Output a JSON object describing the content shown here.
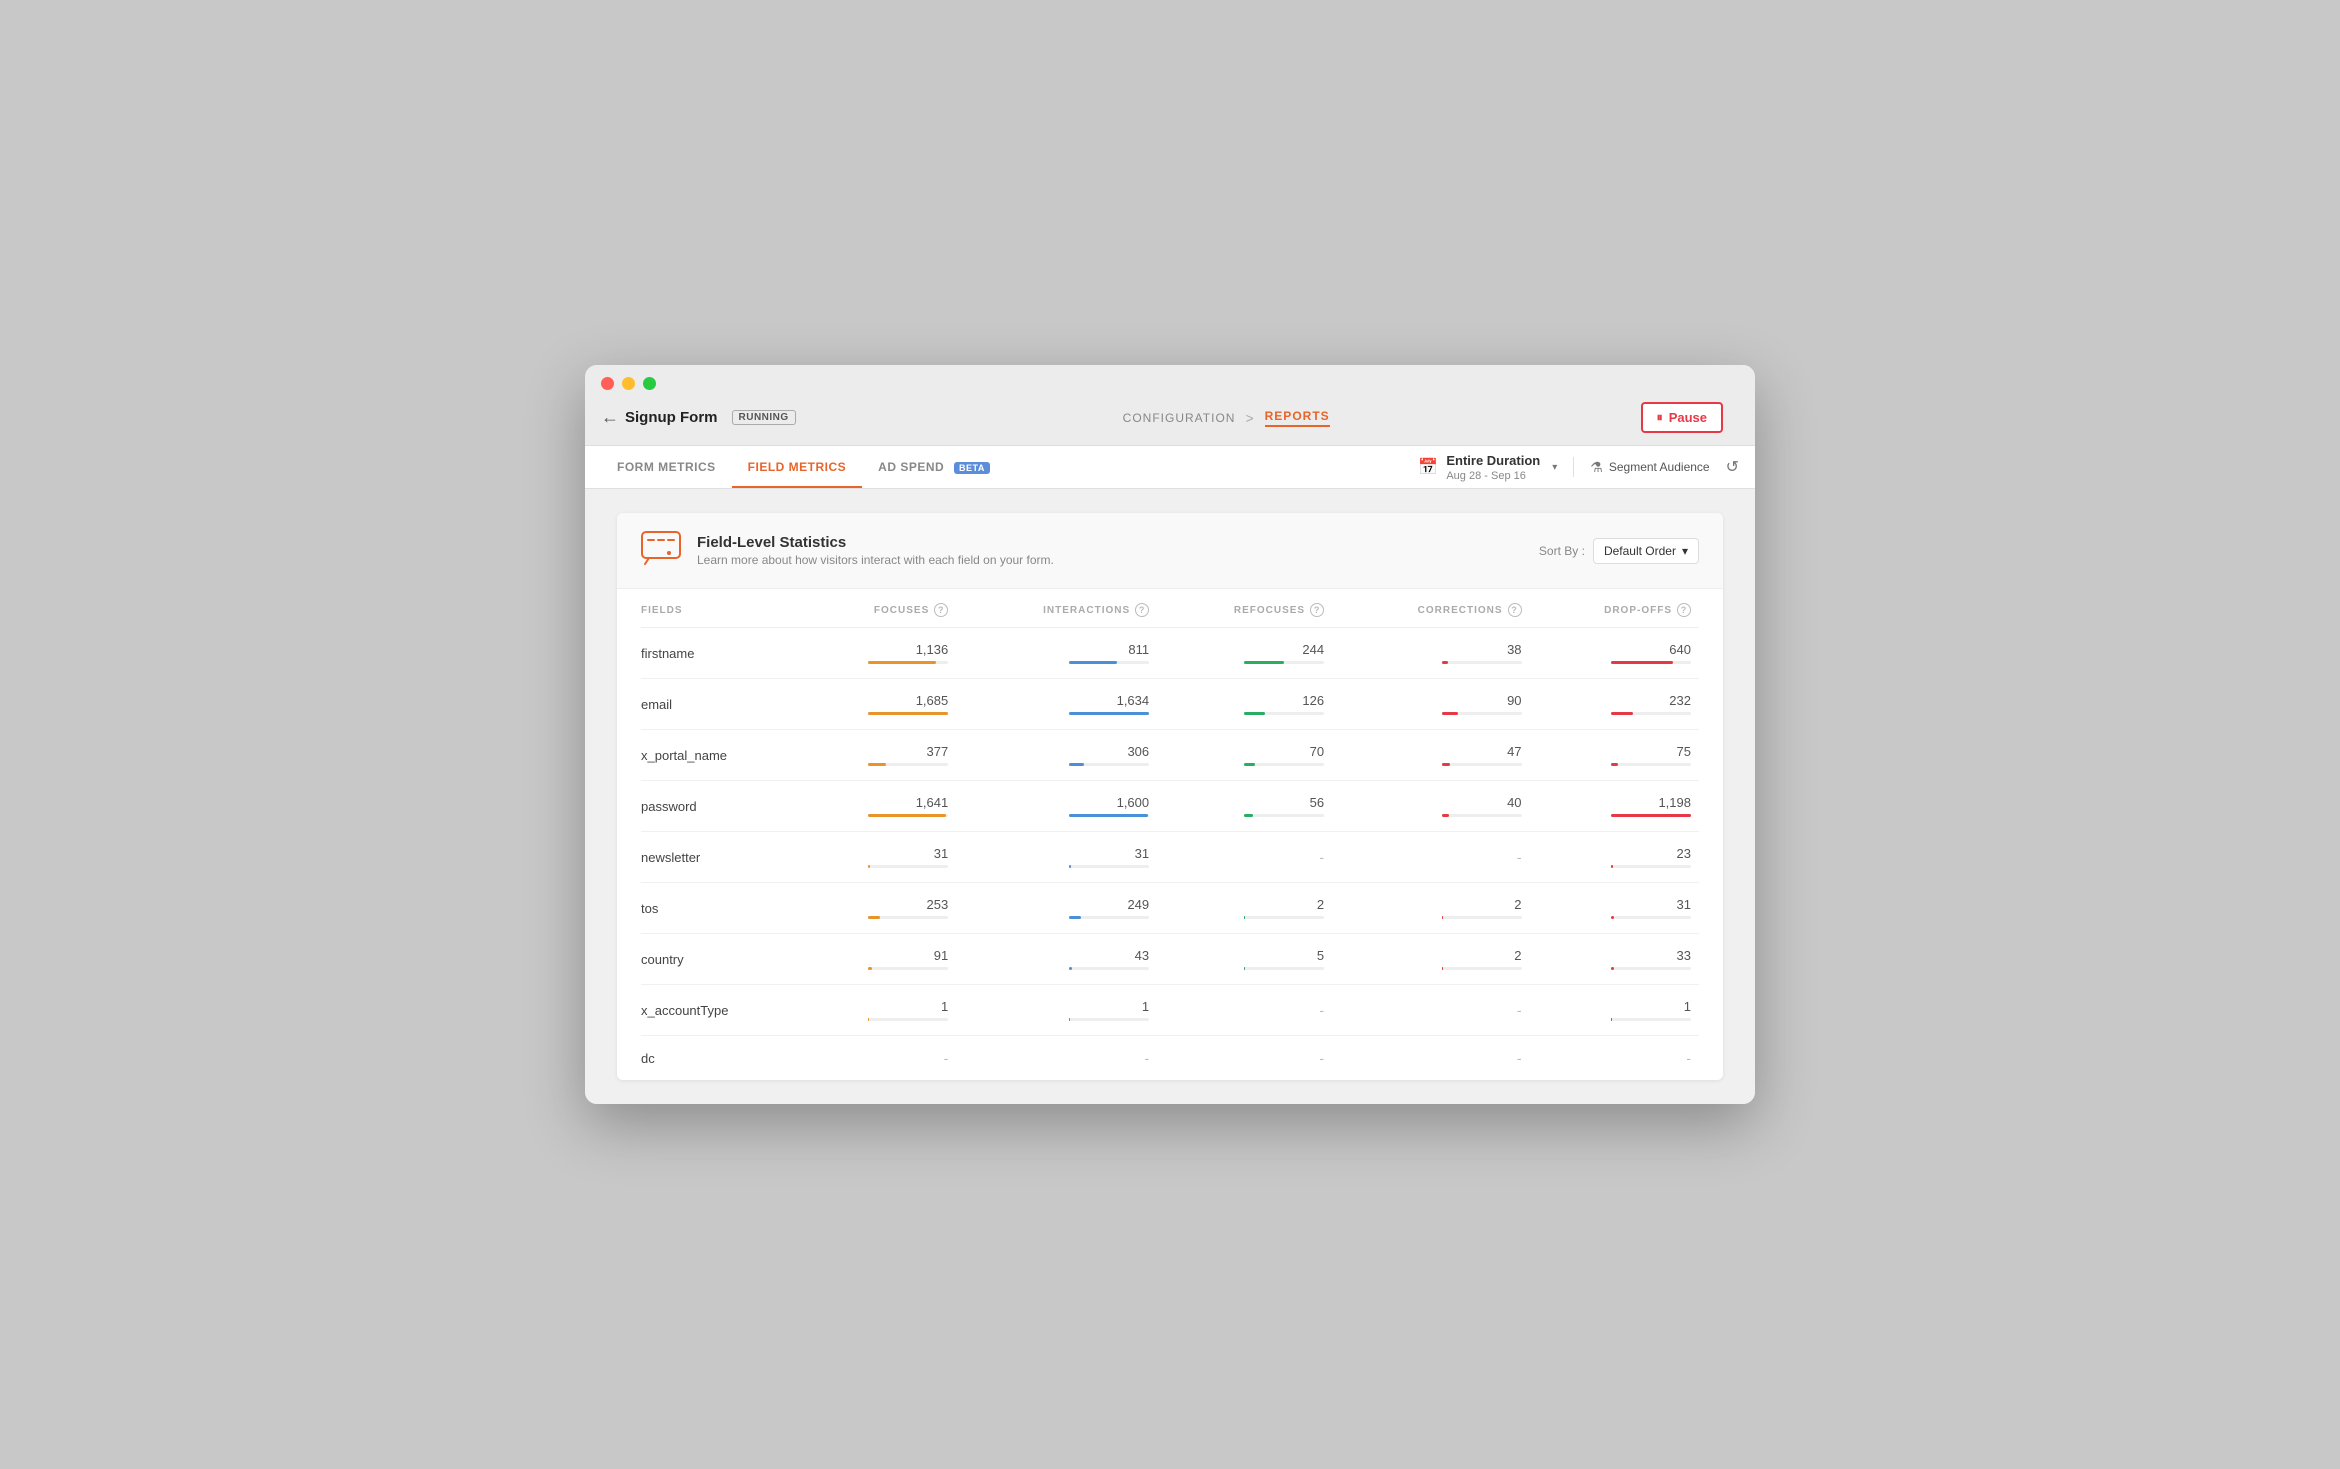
{
  "window": {
    "title": "Signup Form"
  },
  "header": {
    "back_label": "Signup Form",
    "running_badge": "RUNNING",
    "breadcrumb_config": "CONFIGURATION",
    "breadcrumb_sep": ">",
    "breadcrumb_reports": "REPORTS",
    "pause_label": "Pause"
  },
  "nav": {
    "tabs": [
      {
        "id": "form-metrics",
        "label": "FORM METRICS",
        "active": false
      },
      {
        "id": "field-metrics",
        "label": "FIELD METRICS",
        "active": true
      },
      {
        "id": "ad-spend",
        "label": "AD SPEND",
        "active": false,
        "beta": true
      }
    ],
    "date_label": "Entire Duration",
    "date_sub": "Aug 28 - Sep 16",
    "segment_label": "Segment Audience",
    "sort_label": "Sort By :",
    "sort_value": "Default Order"
  },
  "stats": {
    "title": "Field-Level Statistics",
    "subtitle": "Learn more about how visitors interact with each field on your form.",
    "columns": [
      "FIELDS",
      "FOCUSES",
      "INTERACTIONS",
      "REFOCUSES",
      "CORRECTIONS",
      "DROP-OFFS"
    ],
    "rows": [
      {
        "field": "firstname",
        "focuses": "1,136",
        "focuses_pct": 85,
        "interactions": "811",
        "interactions_pct": 60,
        "refocuses": "244",
        "refocuses_pct": 50,
        "corrections": "38",
        "corrections_pct": 8,
        "dropoffs": "640",
        "dropoffs_pct": 78
      },
      {
        "field": "email",
        "focuses": "1,685",
        "focuses_pct": 100,
        "interactions": "1,634",
        "interactions_pct": 100,
        "refocuses": "126",
        "refocuses_pct": 26,
        "corrections": "90",
        "corrections_pct": 20,
        "dropoffs": "232",
        "dropoffs_pct": 28
      },
      {
        "field": "x_portal_name",
        "focuses": "377",
        "focuses_pct": 22,
        "interactions": "306",
        "interactions_pct": 19,
        "refocuses": "70",
        "refocuses_pct": 14,
        "corrections": "47",
        "corrections_pct": 10,
        "dropoffs": "75",
        "dropoffs_pct": 9
      },
      {
        "field": "password",
        "focuses": "1,641",
        "focuses_pct": 97,
        "interactions": "1,600",
        "interactions_pct": 98,
        "refocuses": "56",
        "refocuses_pct": 11,
        "corrections": "40",
        "corrections_pct": 9,
        "dropoffs": "1,198",
        "dropoffs_pct": 100
      },
      {
        "field": "newsletter",
        "focuses": "31",
        "focuses_pct": 2,
        "interactions": "31",
        "interactions_pct": 2,
        "refocuses": "-",
        "refocuses_pct": 0,
        "corrections": "-",
        "corrections_pct": 0,
        "dropoffs": "23",
        "dropoffs_pct": 3
      },
      {
        "field": "tos",
        "focuses": "253",
        "focuses_pct": 15,
        "interactions": "249",
        "interactions_pct": 15,
        "refocuses": "2",
        "refocuses_pct": 1,
        "corrections": "2",
        "corrections_pct": 0,
        "dropoffs": "31",
        "dropoffs_pct": 4
      },
      {
        "field": "country",
        "focuses": "91",
        "focuses_pct": 5,
        "interactions": "43",
        "interactions_pct": 3,
        "refocuses": "5",
        "refocuses_pct": 1,
        "corrections": "2",
        "corrections_pct": 0,
        "dropoffs": "33",
        "dropoffs_pct": 4
      },
      {
        "field": "x_accountType",
        "focuses": "1",
        "focuses_pct": 0,
        "interactions": "1",
        "interactions_pct": 0,
        "refocuses": "-",
        "refocuses_pct": 0,
        "corrections": "-",
        "corrections_pct": 0,
        "dropoffs": "1",
        "dropoffs_pct": 0
      },
      {
        "field": "dc",
        "focuses": "-",
        "focuses_pct": 0,
        "interactions": "-",
        "interactions_pct": 0,
        "refocuses": "-",
        "refocuses_pct": 0,
        "corrections": "-",
        "corrections_pct": 0,
        "dropoffs": "-",
        "dropoffs_pct": 0
      }
    ]
  },
  "colors": {
    "accent": "#e8642a",
    "pause_red": "#e63946",
    "running_green": "#28ca41",
    "bar_orange": "#e8942a",
    "bar_blue": "#4a90d9",
    "bar_green": "#27ae60",
    "bar_red": "#e63946"
  }
}
